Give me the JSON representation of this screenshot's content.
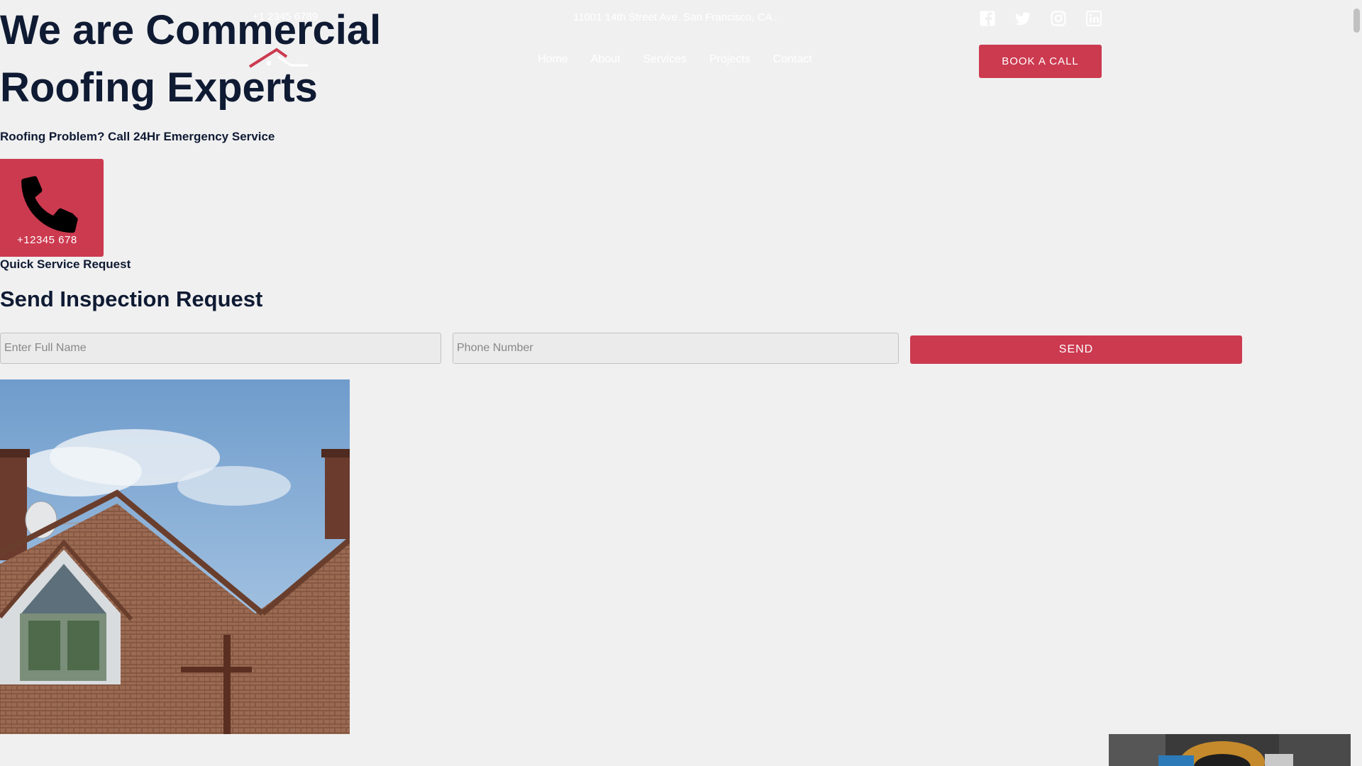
{
  "topbar": {
    "phone": "+1 2345 6789",
    "address": "11001 14th Street Ave. San Francisco, CA ."
  },
  "social": [
    "facebook-icon",
    "twitter-icon",
    "instagram-icon",
    "linkedin-icon"
  ],
  "nav": {
    "items": [
      "Home",
      "About",
      "Services",
      "Projects",
      "Contact"
    ]
  },
  "header": {
    "book_label": "BOOK A CALL"
  },
  "hero": {
    "title": "We are Commercial Roofing Experts",
    "subtitle": "Roofing Problem? Call 24Hr Emergency Service",
    "call_number": "+12345 678",
    "quick_label": "Quick Service Request"
  },
  "form": {
    "title": "Send Inspection Request",
    "name_placeholder": "Enter Full Name",
    "phone_placeholder": "Phone Number",
    "send_label": "SEND"
  },
  "colors": {
    "accent": "#cc3a50",
    "heading": "#0f1a33",
    "background": "#f0f0f0"
  }
}
